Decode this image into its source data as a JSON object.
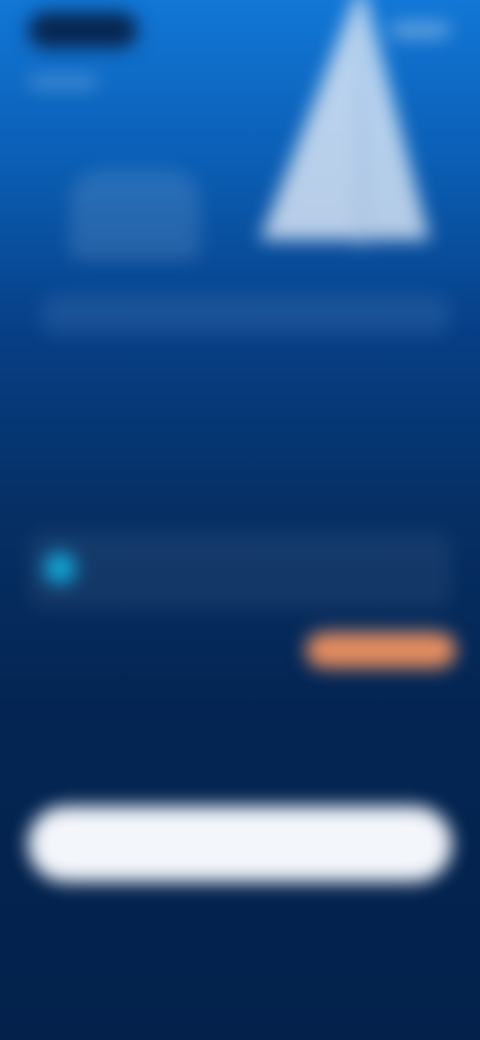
{
  "app": {
    "brand": ""
  },
  "hero": {
    "eyebrow": "",
    "headline": ""
  },
  "features": [
    {
      "title": "",
      "subtitle": ""
    },
    {
      "title": "",
      "subtitle": ""
    }
  ],
  "actions": {
    "primary_label": "",
    "badge_label": "",
    "footer_link": ""
  },
  "colors": {
    "background_top": "#1277d6",
    "background_bottom": "#03214b",
    "accent": "#13a8d8",
    "badge": "#e58d5f",
    "button": "#f3f6fb"
  },
  "icons": {
    "hero": "sailboat-icon",
    "feature_1": "circle-icon"
  }
}
